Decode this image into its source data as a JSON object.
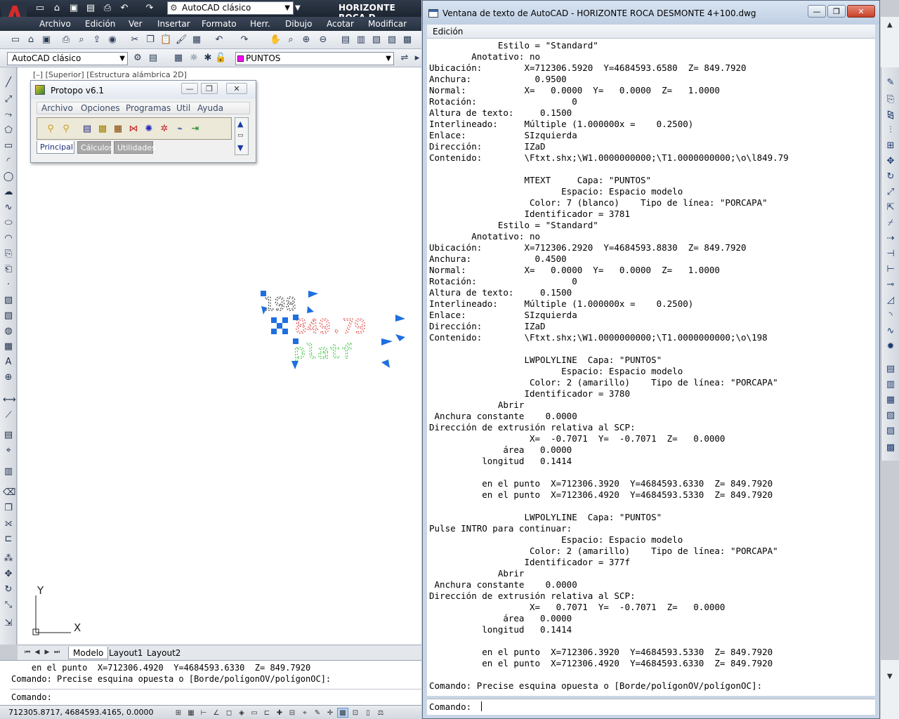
{
  "app": {
    "workspace": "AutoCAD clásico",
    "title": "HORIZONTE ROCA D",
    "menu": [
      "Archivo",
      "Edición",
      "Ver",
      "Insertar",
      "Formato",
      "Herr.",
      "Dibujo",
      "Acotar",
      "Modificar"
    ],
    "workspace2": "AutoCAD clásico",
    "layer": "PUNTOS",
    "layer_color": "#ff00ff",
    "viewport_label": "[–] [Superior] [Estructura alámbrica 2D]",
    "ucs": {
      "x_label": "X",
      "y_label": "Y"
    },
    "drawing": {
      "text_red": "849.79",
      "text_green": "platf",
      "text_dashed": "198"
    },
    "layout_tabs": [
      "Modelo",
      "Layout1",
      "Layout2"
    ],
    "command_history": [
      "    en el punto  X=712306.4920  Y=4684593.6330  Z= 849.7920",
      "Comando: Precise esquina opuesta o [Borde/polígonOV/polígonOC]:"
    ],
    "command_prompt": "Comando:",
    "coords": "712305.8717, 4684593.4165, 0.0000"
  },
  "protopo": {
    "title": "Protopo v6.1",
    "menu": [
      "Archivo",
      "Opciones",
      "Programas",
      "Util",
      "Ayuda"
    ],
    "tabs": [
      "Principal",
      "Cálculos",
      "Utilidades"
    ]
  },
  "textwin": {
    "title": "Ventana de texto de AutoCAD - HORIZONTE ROCA  DESMONTE 4+100.dwg",
    "menu_edicion": "Edición",
    "lines": [
      "             Estilo = \"Standard\"",
      "        Anotativo: no",
      "Ubicación:        X=712306.5920  Y=4684593.6580  Z= 849.7920",
      "Anchura:            0.9500",
      "Normal:           X=   0.0000  Y=   0.0000  Z=   1.0000",
      "Rotación:                  0",
      "Altura de texto:     0.1500",
      "Interlineado:     Múltiple (1.000000x =    0.2500)",
      "Enlace:           SIzquierda",
      "Dirección:        IZaD",
      "Contenido:        \\Ftxt.shx;\\W1.0000000000;\\T1.0000000000;\\o\\l849.79",
      "",
      "                  MTEXT     Capa: \"PUNTOS\"",
      "                         Espacio: Espacio modelo",
      "                   Color: 7 (blanco)    Tipo de línea: \"PORCAPA\"",
      "                  Identificador = 3781",
      "             Estilo = \"Standard\"",
      "        Anotativo: no",
      "Ubicación:        X=712306.2920  Y=4684593.8830  Z= 849.7920",
      "Anchura:            0.4500",
      "Normal:           X=   0.0000  Y=   0.0000  Z=   1.0000",
      "Rotación:                  0",
      "Altura de texto:     0.1500",
      "Interlineado:     Múltiple (1.000000x =    0.2500)",
      "Enlace:           SIzquierda",
      "Dirección:        IZaD",
      "Contenido:        \\Ftxt.shx;\\W1.0000000000;\\T1.0000000000;\\o\\198",
      "",
      "                  LWPOLYLINE  Capa: \"PUNTOS\"",
      "                         Espacio: Espacio modelo",
      "                   Color: 2 (amarillo)    Tipo de línea: \"PORCAPA\"",
      "                  Identificador = 3780",
      "             Abrir",
      " Anchura constante    0.0000",
      "Dirección de extrusión relativa al SCP:",
      "                   X=  -0.7071  Y=  -0.7071  Z=   0.0000",
      "              área   0.0000",
      "          longitud   0.1414",
      "",
      "          en el punto  X=712306.3920  Y=4684593.6330  Z= 849.7920",
      "          en el punto  X=712306.4920  Y=4684593.5330  Z= 849.7920",
      "",
      "                  LWPOLYLINE  Capa: \"PUNTOS\"",
      "Pulse INTRO para continuar:",
      "                         Espacio: Espacio modelo",
      "                   Color: 2 (amarillo)    Tipo de línea: \"PORCAPA\"",
      "                  Identificador = 377f",
      "             Abrir",
      " Anchura constante    0.0000",
      "Dirección de extrusión relativa al SCP:",
      "                   X=   0.7071  Y=  -0.7071  Z=   0.0000",
      "              área   0.0000",
      "          longitud   0.1414",
      "",
      "          en el punto  X=712306.3920  Y=4684593.5330  Z= 849.7920",
      "          en el punto  X=712306.4920  Y=4684593.6330  Z= 849.7920",
      "",
      "Comando: Precise esquina opuesta o [Borde/polígonOV/polígonOC]:"
    ],
    "command_prompt": "Comando:",
    "command_value": ""
  }
}
